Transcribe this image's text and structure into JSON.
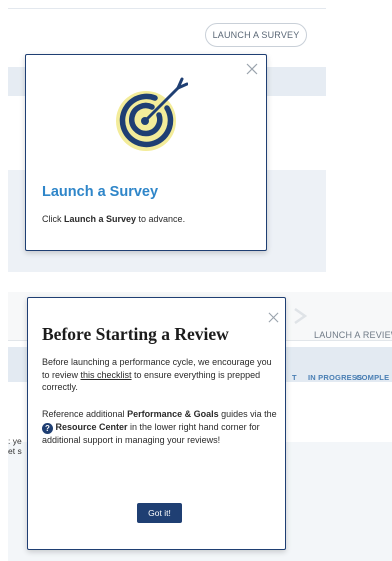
{
  "survey_panel": {
    "launch_button_label": "LAUNCH A SURVEY",
    "modal": {
      "title": "Launch a Survey",
      "body_prefix": "Click ",
      "body_bold": "Launch a Survey",
      "body_suffix": " to advance."
    }
  },
  "review_panel": {
    "launch_label": "LAUNCH A REVIEW",
    "tabs": [
      "T",
      "IN PROGRESS",
      "COMPLE"
    ],
    "background_snippets": [
      ": ye",
      "et s"
    ],
    "modal": {
      "title": "Before Starting a Review",
      "para1_prefix": "Before launching a performance cycle, we encourage you to review ",
      "para1_link": "this checklist",
      "para1_suffix": " to ensure everything is prepped correctly.",
      "para2_prefix": "Reference additional ",
      "para2_bold1": "Performance & Goals",
      "para2_mid": " guides via the ",
      "resource_icon_glyph": "?",
      "para2_bold2": "Resource Center",
      "para2_suffix": " in the lower right hand corner for additional support in managing your reviews!",
      "button_label": "Got it!"
    }
  },
  "colors": {
    "accent_blue": "#2f86c9",
    "navy": "#1f3f73",
    "target_yellow": "#f3ec9a"
  },
  "icons": [
    "close-icon",
    "target-arrow-icon",
    "chevron-right-icon",
    "resource-center-icon"
  ]
}
